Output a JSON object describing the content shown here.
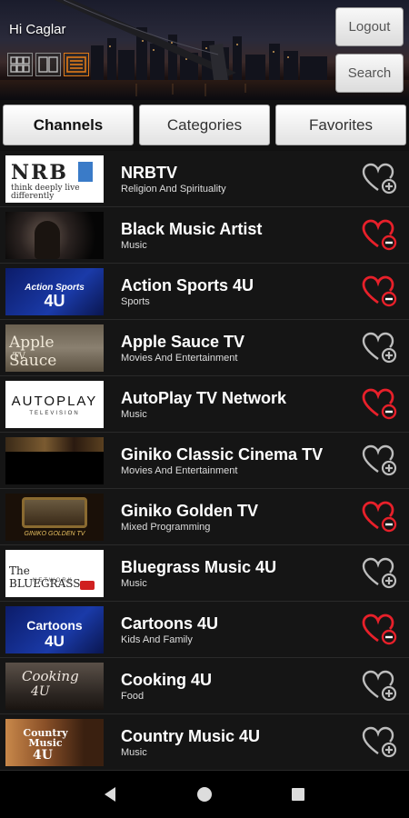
{
  "header": {
    "greeting": "Hi Caglar",
    "logout_label": "Logout",
    "search_label": "Search",
    "views": [
      "grid-view",
      "split-view",
      "list-view"
    ],
    "active_view": "list-view"
  },
  "tabs": [
    {
      "label": "Channels",
      "active": true
    },
    {
      "label": "Categories",
      "active": false
    },
    {
      "label": "Favorites",
      "active": false
    }
  ],
  "channels": [
    {
      "name": "NRBTV",
      "category": "Religion And Spirituality",
      "favorite": false,
      "thumb_text": "NRB",
      "thumb_sub": "think deeply live differently"
    },
    {
      "name": "Black Music Artist",
      "category": "Music",
      "favorite": true,
      "thumb_text": "",
      "thumb_sub": ""
    },
    {
      "name": "Action Sports 4U",
      "category": "Sports",
      "favorite": true,
      "thumb_text": "Action Sports",
      "thumb_sub": "4U"
    },
    {
      "name": "Apple Sauce TV",
      "category": "Movies And Entertainment",
      "favorite": false,
      "thumb_text": "Apple Sauce",
      "thumb_sub": "TV"
    },
    {
      "name": "AutoPlay TV Network",
      "category": "Music",
      "favorite": true,
      "thumb_text": "AUTOPLAY",
      "thumb_sub": "TELEVISION"
    },
    {
      "name": "Giniko Classic Cinema TV",
      "category": "Movies And Entertainment",
      "favorite": false,
      "thumb_text": "",
      "thumb_sub": ""
    },
    {
      "name": "Giniko Golden TV",
      "category": "Mixed Programming",
      "favorite": true,
      "thumb_text": "",
      "thumb_sub": "GINIKO GOLDEN TV"
    },
    {
      "name": "Bluegrass Music 4U",
      "category": "Music",
      "favorite": false,
      "thumb_text": "The BLUEGRASS",
      "thumb_sub": "NETWORK"
    },
    {
      "name": "Cartoons 4U",
      "category": "Kids And Family",
      "favorite": true,
      "thumb_text": "Cartoons",
      "thumb_sub": "4U"
    },
    {
      "name": "Cooking 4U",
      "category": "Food",
      "favorite": false,
      "thumb_text": "Cooking",
      "thumb_sub": "4U"
    },
    {
      "name": "Country Music 4U",
      "category": "Music",
      "favorite": false,
      "thumb_text": "Country Music",
      "thumb_sub": "4U"
    }
  ],
  "colors": {
    "accent_orange": "#e07a18",
    "favorite_red": "#e8202a",
    "unfavorite_gray": "#bdbdbd"
  }
}
